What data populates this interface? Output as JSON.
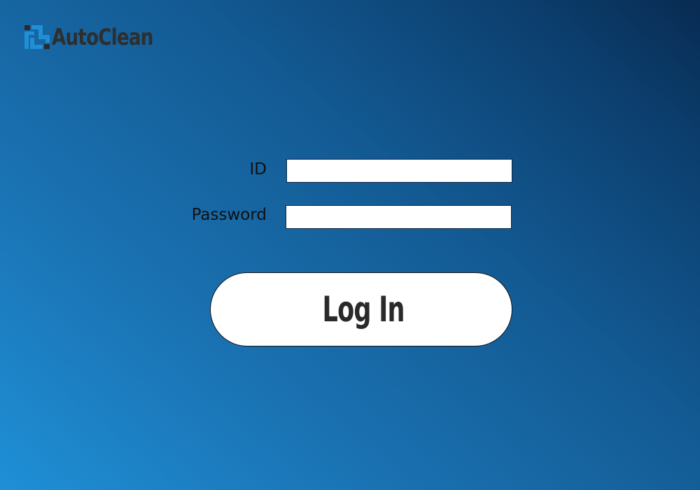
{
  "brand": {
    "name": "AutoClean",
    "logo_icon": "autoclean-logo-icon",
    "icon_colors": [
      "#1f8fd6",
      "#2a2a2a"
    ]
  },
  "login_form": {
    "id_label": "ID",
    "id_value": "",
    "password_label": "Password",
    "password_value": "",
    "submit_label": "Log In"
  },
  "colors": {
    "background_start": "#1f8fd6",
    "background_end": "#082b52",
    "button_background": "#ffffff",
    "button_text": "#2a2a2a"
  }
}
